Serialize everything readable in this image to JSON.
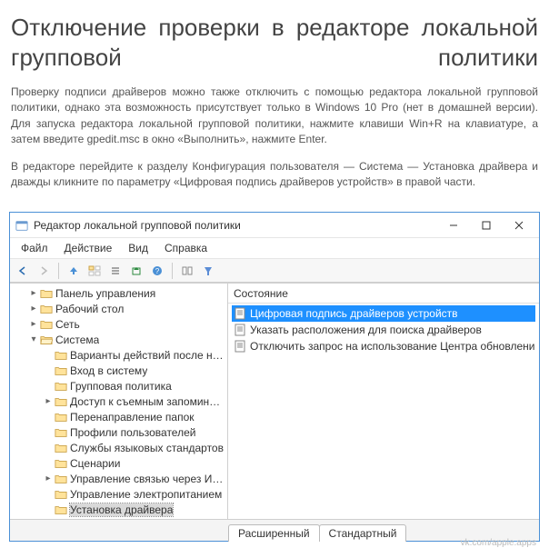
{
  "article": {
    "heading": "Отключение проверки в редакторе локальной групповой политики",
    "p1": "Проверку подписи драйверов можно также отключить с помощью редактора локальной групповой политики, однако эта возможность присутствует только в Windows 10 Pro (нет в домашней версии). Для запуска редактора локальной групповой политики, нажмите клавиши Win+R на клавиатуре, а затем введите gpedit.msc в окно «Выполнить», нажмите Enter.",
    "p2": "В редакторе перейдите к разделу Конфигурация пользователя — Система — Установка драйвера и дважды кликните по параметру «Цифровая подпись драйверов устройств» в правой части."
  },
  "window": {
    "title": "Редактор локальной групповой политики",
    "menus": [
      "Файл",
      "Действие",
      "Вид",
      "Справка"
    ],
    "toolbar_icons": [
      "arrow-left-icon",
      "arrow-right-icon",
      "arrow-up-icon",
      "folder-tree-icon",
      "list-icon",
      "export-icon",
      "help-icon",
      "columns-icon",
      "filter-icon"
    ],
    "list": {
      "header": "Состояние",
      "items": [
        {
          "label": "Цифровая подпись драйверов устройств",
          "selected": true
        },
        {
          "label": "Указать расположения для поиска драйверов",
          "selected": false
        },
        {
          "label": "Отключить запрос на использование Центра обновлени...",
          "selected": false
        }
      ]
    },
    "tabs": {
      "extended": "Расширенный",
      "standard": "Стандартный"
    },
    "tree": [
      {
        "depth": 1,
        "label": "Панель управления",
        "exp": ">"
      },
      {
        "depth": 1,
        "label": "Рабочий стол",
        "exp": ">"
      },
      {
        "depth": 1,
        "label": "Сеть",
        "exp": ">"
      },
      {
        "depth": 1,
        "label": "Система",
        "exp": "v",
        "open": true
      },
      {
        "depth": 2,
        "label": "Варианты действий после нажати",
        "exp": ""
      },
      {
        "depth": 2,
        "label": "Вход в систему",
        "exp": ""
      },
      {
        "depth": 2,
        "label": "Групповая политика",
        "exp": ""
      },
      {
        "depth": 2,
        "label": "Доступ к съемным запоминающ",
        "exp": ">"
      },
      {
        "depth": 2,
        "label": "Перенаправление папок",
        "exp": ""
      },
      {
        "depth": 2,
        "label": "Профили пользователей",
        "exp": ""
      },
      {
        "depth": 2,
        "label": "Службы языковых стандартов",
        "exp": ""
      },
      {
        "depth": 2,
        "label": "Сценарии",
        "exp": ""
      },
      {
        "depth": 2,
        "label": "Управление связью через Интерне",
        "exp": ">"
      },
      {
        "depth": 2,
        "label": "Управление электропитанием",
        "exp": ""
      },
      {
        "depth": 2,
        "label": "Установка драйвера",
        "exp": "",
        "selected": true
      }
    ]
  },
  "watermark": "vk.com/apple.apps"
}
